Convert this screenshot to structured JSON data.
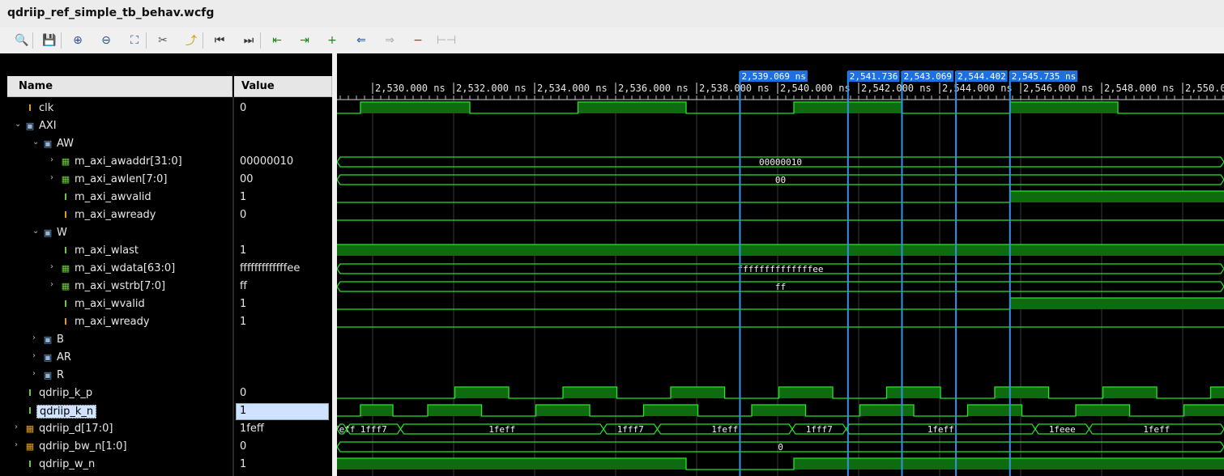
{
  "window": {
    "title": "qdriip_ref_simple_tb_behav.wcfg"
  },
  "toolbar": [
    {
      "name": "search-icon",
      "glyph": "🔍"
    },
    {
      "name": "save-icon",
      "glyph": "💾"
    },
    {
      "name": "zoom-in-icon",
      "glyph": "⊕"
    },
    {
      "name": "zoom-out-icon",
      "glyph": "⊖"
    },
    {
      "name": "zoom-fit-icon",
      "glyph": "⛶"
    },
    {
      "name": "cursor-to-zero-icon",
      "glyph": "✂"
    },
    {
      "name": "go-to-cursor-icon",
      "glyph": "⤴"
    },
    {
      "name": "go-to-start-icon",
      "glyph": "⏮"
    },
    {
      "name": "go-to-end-icon",
      "glyph": "⏭"
    },
    {
      "name": "previous-transition-icon",
      "glyph": "⇤"
    },
    {
      "name": "next-transition-icon",
      "glyph": "⇥"
    },
    {
      "name": "add-marker-icon",
      "glyph": "+"
    },
    {
      "name": "previous-marker-icon",
      "glyph": "⇐"
    },
    {
      "name": "next-marker-icon",
      "glyph": "⇒"
    },
    {
      "name": "delete-marker-icon",
      "glyph": "−"
    },
    {
      "name": "swap-cursors-icon",
      "glyph": "⊢⊣"
    }
  ],
  "columns": {
    "name": "Name",
    "value": "Value"
  },
  "signals": [
    {
      "name": "clk",
      "value": "0",
      "depth": 0,
      "expand": "",
      "icon": "bit-orange"
    },
    {
      "name": "AXI",
      "value": "",
      "depth": 0,
      "expand": "open",
      "icon": "group"
    },
    {
      "name": "AW",
      "value": "",
      "depth": 1,
      "expand": "open",
      "icon": "group"
    },
    {
      "name": "m_axi_awaddr[31:0]",
      "value": "00000010",
      "depth": 2,
      "expand": "closed",
      "icon": "bus-green"
    },
    {
      "name": "m_axi_awlen[7:0]",
      "value": "00",
      "depth": 2,
      "expand": "closed",
      "icon": "bus-green"
    },
    {
      "name": "m_axi_awvalid",
      "value": "1",
      "depth": 2,
      "expand": "",
      "icon": "bit-green"
    },
    {
      "name": "m_axi_awready",
      "value": "0",
      "depth": 2,
      "expand": "",
      "icon": "bit-orange"
    },
    {
      "name": "W",
      "value": "",
      "depth": 1,
      "expand": "open",
      "icon": "group"
    },
    {
      "name": "m_axi_wlast",
      "value": "1",
      "depth": 2,
      "expand": "",
      "icon": "bit-green"
    },
    {
      "name": "m_axi_wdata[63:0]",
      "value": "fffffffffffffee",
      "depth": 2,
      "expand": "closed",
      "icon": "bus-green"
    },
    {
      "name": "m_axi_wstrb[7:0]",
      "value": "ff",
      "depth": 2,
      "expand": "closed",
      "icon": "bus-green"
    },
    {
      "name": "m_axi_wvalid",
      "value": "1",
      "depth": 2,
      "expand": "",
      "icon": "bit-green"
    },
    {
      "name": "m_axi_wready",
      "value": "1",
      "depth": 2,
      "expand": "",
      "icon": "bit-orange"
    },
    {
      "name": "B",
      "value": "",
      "depth": 1,
      "expand": "closed",
      "icon": "group"
    },
    {
      "name": "AR",
      "value": "",
      "depth": 1,
      "expand": "closed",
      "icon": "group"
    },
    {
      "name": "R",
      "value": "",
      "depth": 1,
      "expand": "closed",
      "icon": "group"
    },
    {
      "name": "qdriip_k_p",
      "value": "0",
      "depth": 0,
      "expand": "",
      "icon": "bit-green"
    },
    {
      "name": "qdriip_k_n",
      "value": "1",
      "depth": 0,
      "expand": "",
      "icon": "bit-green",
      "selected": true
    },
    {
      "name": "qdriip_d[17:0]",
      "value": "1feff",
      "depth": 0,
      "expand": "closed",
      "icon": "bus-orange"
    },
    {
      "name": "qdriip_bw_n[1:0]",
      "value": "0",
      "depth": 0,
      "expand": "closed",
      "icon": "bus-orange"
    },
    {
      "name": "qdriip_w_n",
      "value": "1",
      "depth": 0,
      "expand": "",
      "icon": "bit-green"
    }
  ],
  "timeline": {
    "ticks": [
      "2,530.000 ns",
      "2,532.000 ns",
      "2,534.000 ns",
      "2,536.000 ns",
      "2,538.000 ns",
      "2,540.000 ns",
      "2,542.000 ns",
      "2,544.000 ns",
      "2,546.000 ns",
      "2,548.000 ns",
      "2,550.0"
    ],
    "tick_ns": [
      2530,
      2532,
      2534,
      2536,
      2538,
      2540,
      2542,
      2544,
      2546,
      2548,
      2550
    ],
    "markers": [
      {
        "label": "2,539.069 ns",
        "t": 2539.069
      },
      {
        "label": "2,541.736",
        "t": 2541.736
      },
      {
        "label": "2,543.069",
        "t": 2543.069
      },
      {
        "label": "2,544.402",
        "t": 2544.402
      },
      {
        "label": "2,545.735 ns",
        "t": 2545.735
      }
    ]
  },
  "waves": {
    "clk": {
      "initial": 0,
      "toggles": [
        2529.7,
        2532.4,
        2535.07,
        2537.74,
        2540.4,
        2543.07,
        2545.74,
        2548.4
      ]
    },
    "awvalid": {
      "initial": 0,
      "toggles": [
        2545.735
      ]
    },
    "awready": {
      "initial": 0,
      "toggles": []
    },
    "wlast": {
      "initial": 1,
      "toggles": []
    },
    "wvalid": {
      "initial": 0,
      "toggles": [
        2545.735
      ]
    },
    "wready": {
      "initial": 0,
      "toggles": []
    },
    "k_p": {
      "initial": 1,
      "toggles": [
        2529.07,
        2532.03,
        2533.36,
        2534.7,
        2536.03,
        2537.36,
        2538.69,
        2540.03,
        2541.36,
        2542.69,
        2544.02,
        2545.36,
        2546.69,
        2548.03,
        2549.36,
        2550.69
      ]
    },
    "k_n": {
      "initial": 0,
      "toggles": [
        2529.7,
        2530.5,
        2531.36,
        2532.69,
        2534.03,
        2535.36,
        2536.69,
        2538.03,
        2539.36,
        2540.69,
        2542.03,
        2543.36,
        2544.69,
        2546.03,
        2547.36,
        2548.69,
        2550.03
      ]
    },
    "w_n": {
      "initial": 1,
      "toggles": [
        2537.74,
        2540.4
      ]
    },
    "awaddr": {
      "segments": [
        {
          "from": 2528.0,
          "to": 2551.9,
          "label": "00000010"
        }
      ]
    },
    "awlen": {
      "segments": [
        {
          "from": 2528.0,
          "to": 2551.9,
          "label": "00"
        }
      ]
    },
    "wdata": {
      "segments": [
        {
          "from": 2528.0,
          "to": 2551.9,
          "label": "ffffffffffffffee"
        }
      ]
    },
    "wstrb": {
      "segments": [
        {
          "from": 2528.0,
          "to": 2551.9,
          "label": "ff"
        }
      ]
    },
    "bw_n": {
      "segments": [
        {
          "from": 2528.0,
          "to": 2551.9,
          "label": "0"
        }
      ]
    },
    "d": {
      "segments": [
        {
          "from": 2528.0,
          "to": 2529.36,
          "label": "1feff"
        },
        {
          "from": 2529.36,
          "to": 2530.69,
          "label": "1fff7"
        },
        {
          "from": 2530.69,
          "to": 2535.7,
          "label": "1feff"
        },
        {
          "from": 2535.7,
          "to": 2537.03,
          "label": "1fff7"
        },
        {
          "from": 2537.03,
          "to": 2540.36,
          "label": "1feff"
        },
        {
          "from": 2540.36,
          "to": 2541.69,
          "label": "1fff7"
        },
        {
          "from": 2541.69,
          "to": 2546.36,
          "label": "1feff"
        },
        {
          "from": 2546.36,
          "to": 2547.69,
          "label": "1feee"
        },
        {
          "from": 2547.69,
          "to": 2551.9,
          "label": "1feff"
        }
      ]
    }
  },
  "colors": {
    "wave": "#27e527",
    "fill": "#0f6b0f",
    "marker": "#3a8fe8",
    "marker_label_bg": "#1f6fe0",
    "grid": "#3a3a3a"
  }
}
